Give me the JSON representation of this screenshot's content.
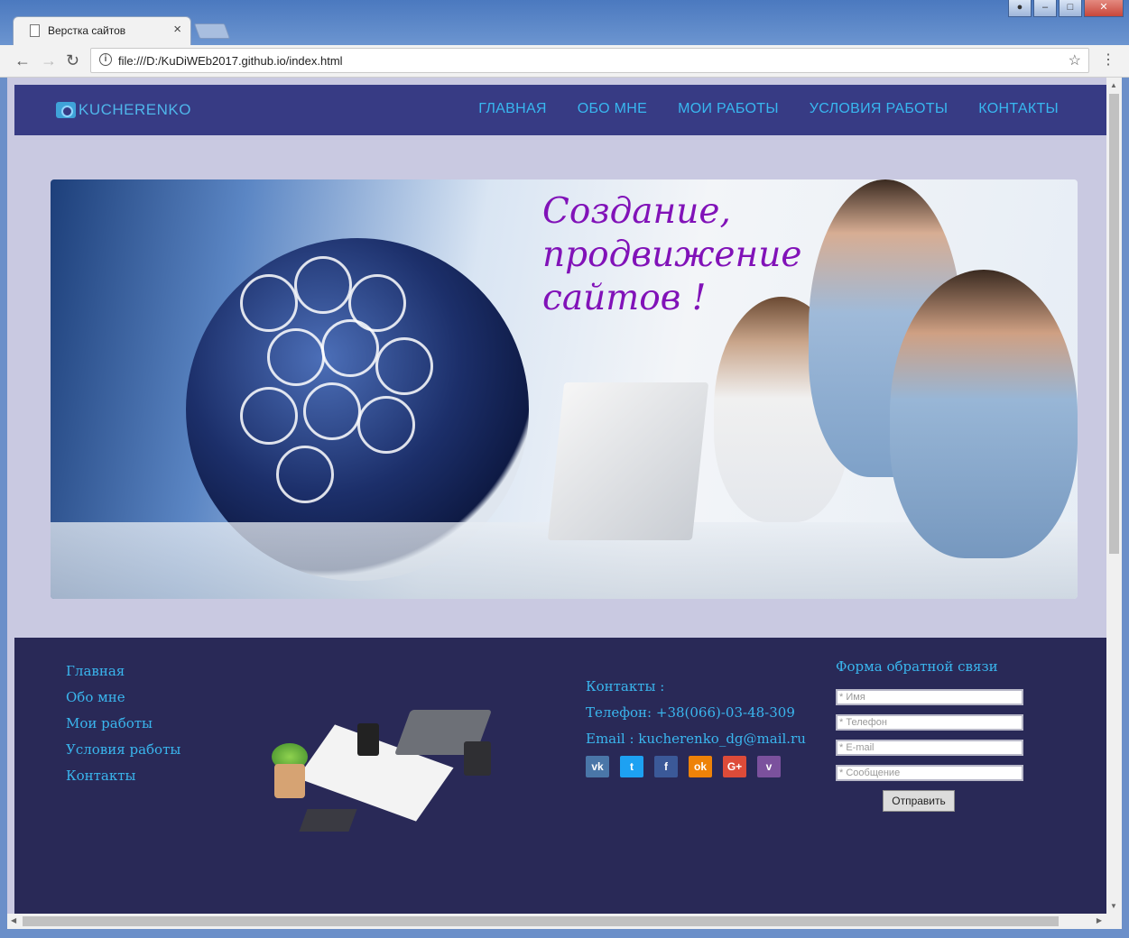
{
  "browser": {
    "tab_title": "Верстка сайтов",
    "url": "file:///D:/KuDiWEb2017.github.io/index.html"
  },
  "site": {
    "logo_text": "KUCHERENKO",
    "nav": [
      "ГЛАВНАЯ",
      "ОБО МНЕ",
      "МОИ РАБОТЫ",
      "УСЛОВИЯ РАБОТЫ",
      "КОНТАКТЫ"
    ],
    "banner_lines": [
      "Создание,",
      "продвижение",
      "сайтов !"
    ],
    "footer_nav": [
      "Главная",
      "Обо мне",
      "Мои работы",
      "Условия работы",
      "Контакты"
    ],
    "contacts": {
      "title": "Контакты :",
      "phone": "Телефон: +38(066)-03-48-309",
      "email": "Email : kucherenko_dg@mail.ru"
    },
    "socials": [
      {
        "name": "vk",
        "label": "vk",
        "color": "#4a76a8"
      },
      {
        "name": "twitter",
        "label": "t",
        "color": "#1da1f2"
      },
      {
        "name": "facebook",
        "label": "f",
        "color": "#3b5998"
      },
      {
        "name": "odnoklassniki",
        "label": "ok",
        "color": "#ee8208"
      },
      {
        "name": "google-plus",
        "label": "G+",
        "color": "#dd4b39"
      },
      {
        "name": "viber",
        "label": "v",
        "color": "#7b519d"
      }
    ],
    "form": {
      "title": "Форма обратной связи",
      "name_placeholder": "* Имя",
      "phone_placeholder": "* Телефон",
      "email_placeholder": "* E-mail",
      "message_placeholder": "* Сообщение",
      "submit": "Отправить"
    },
    "colors": {
      "header_bg": "#373b84",
      "footer_bg": "#292957",
      "page_bg": "#c9c9e1",
      "accent": "#38b7f0",
      "banner_text": "#8112b8"
    }
  }
}
